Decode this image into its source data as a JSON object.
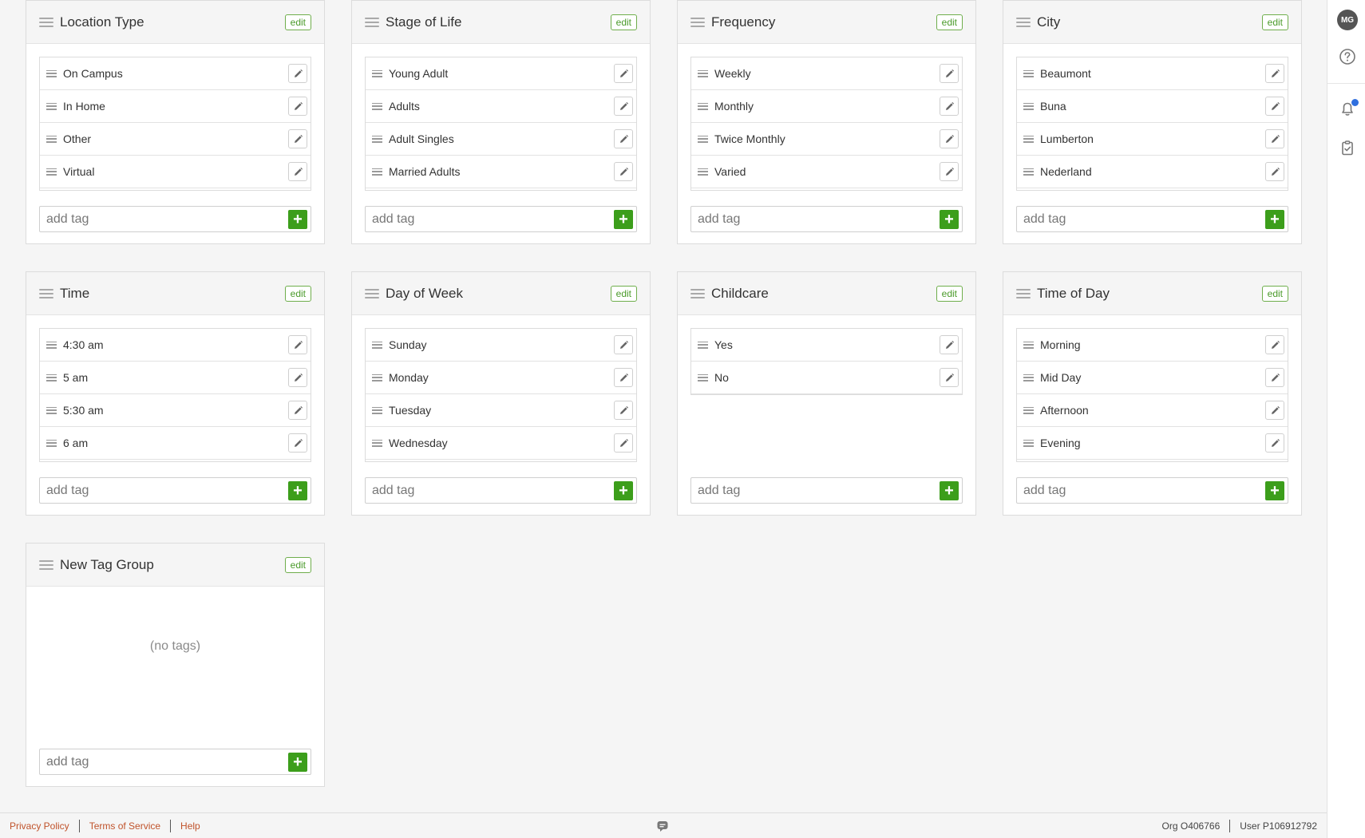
{
  "groups": [
    {
      "title": "Location Type",
      "edit_label": "edit",
      "tags": [
        "On Campus",
        "In Home",
        "Other",
        "Virtual"
      ],
      "add_placeholder": "add tag"
    },
    {
      "title": "Stage of Life",
      "edit_label": "edit",
      "tags": [
        "Young Adult",
        "Adults",
        "Adult Singles",
        "Married Adults"
      ],
      "add_placeholder": "add tag"
    },
    {
      "title": "Frequency",
      "edit_label": "edit",
      "tags": [
        "Weekly",
        "Monthly",
        "Twice Monthly",
        "Varied"
      ],
      "add_placeholder": "add tag"
    },
    {
      "title": "City",
      "edit_label": "edit",
      "tags": [
        "Beaumont",
        "Buna",
        "Lumberton",
        "Nederland"
      ],
      "add_placeholder": "add tag"
    },
    {
      "title": "Time",
      "edit_label": "edit",
      "tags": [
        "4:30 am",
        "5 am",
        "5:30 am",
        "6 am"
      ],
      "add_placeholder": "add tag"
    },
    {
      "title": "Day of Week",
      "edit_label": "edit",
      "tags": [
        "Sunday",
        "Monday",
        "Tuesday",
        "Wednesday"
      ],
      "add_placeholder": "add tag"
    },
    {
      "title": "Childcare",
      "edit_label": "edit",
      "tags": [
        "Yes",
        "No"
      ],
      "add_placeholder": "add tag"
    },
    {
      "title": "Time of Day",
      "edit_label": "edit",
      "tags": [
        "Morning",
        "Mid Day",
        "Afternoon",
        "Evening"
      ],
      "add_placeholder": "add tag"
    },
    {
      "title": "New Tag Group",
      "edit_label": "edit",
      "tags": [],
      "empty_label": "(no tags)",
      "add_placeholder": "add tag"
    }
  ],
  "rail": {
    "avatar_initials": "MG"
  },
  "footer": {
    "privacy": "Privacy Policy",
    "terms": "Terms of Service",
    "help": "Help",
    "org": "Org O406766",
    "user": "User P106912792"
  },
  "colors": {
    "accent_green": "#3c9e1b",
    "link": "#c0532b",
    "notification_dot": "#2f6fde"
  }
}
